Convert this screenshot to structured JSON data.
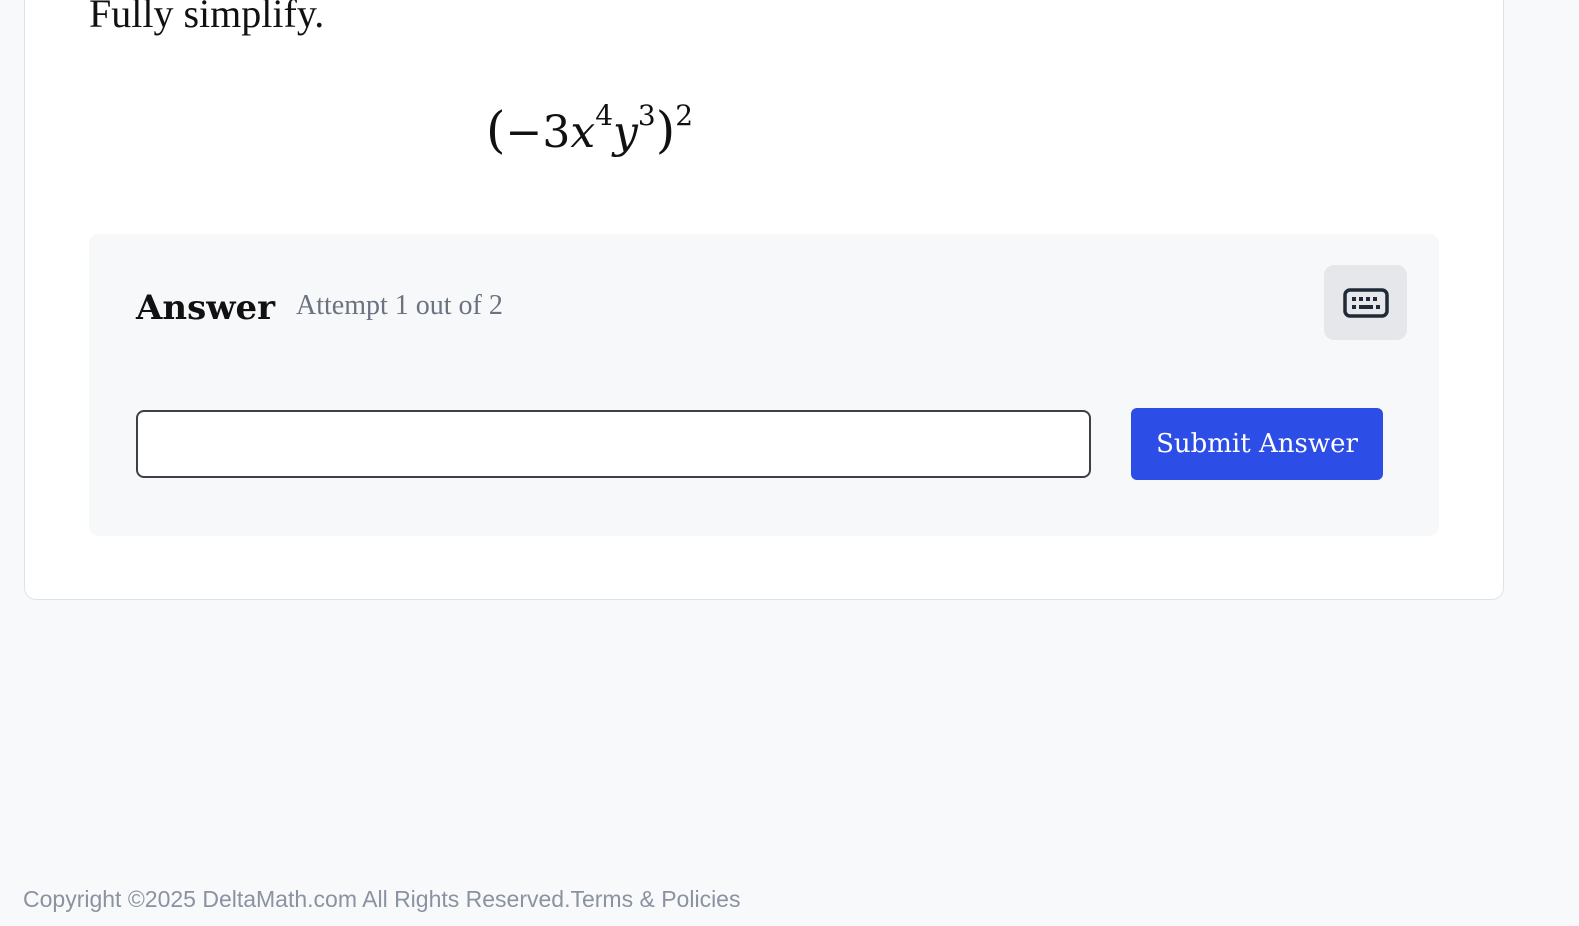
{
  "question": {
    "prompt": "Fully simplify.",
    "expression": {
      "open_paren": "(",
      "minus": "−",
      "coefficient": "3",
      "var_x": "x",
      "exp_x": "4",
      "var_y": "y",
      "exp_y": "3",
      "close_paren": ")",
      "outer_exp": "2"
    }
  },
  "answer": {
    "title": "Answer",
    "attempt_text": "Attempt 1 out of 2",
    "input_value": "",
    "input_placeholder": "",
    "submit_label": "Submit Answer",
    "keyboard_icon": "keyboard-icon"
  },
  "footer": {
    "copyright": "Copyright ©2025 DeltaMath.com All Rights Reserved.",
    "terms_link": "Terms & Policies"
  },
  "colors": {
    "primary_button": "#2d4ee6",
    "page_background": "#f8f9fb",
    "muted_text": "#6b7280"
  }
}
